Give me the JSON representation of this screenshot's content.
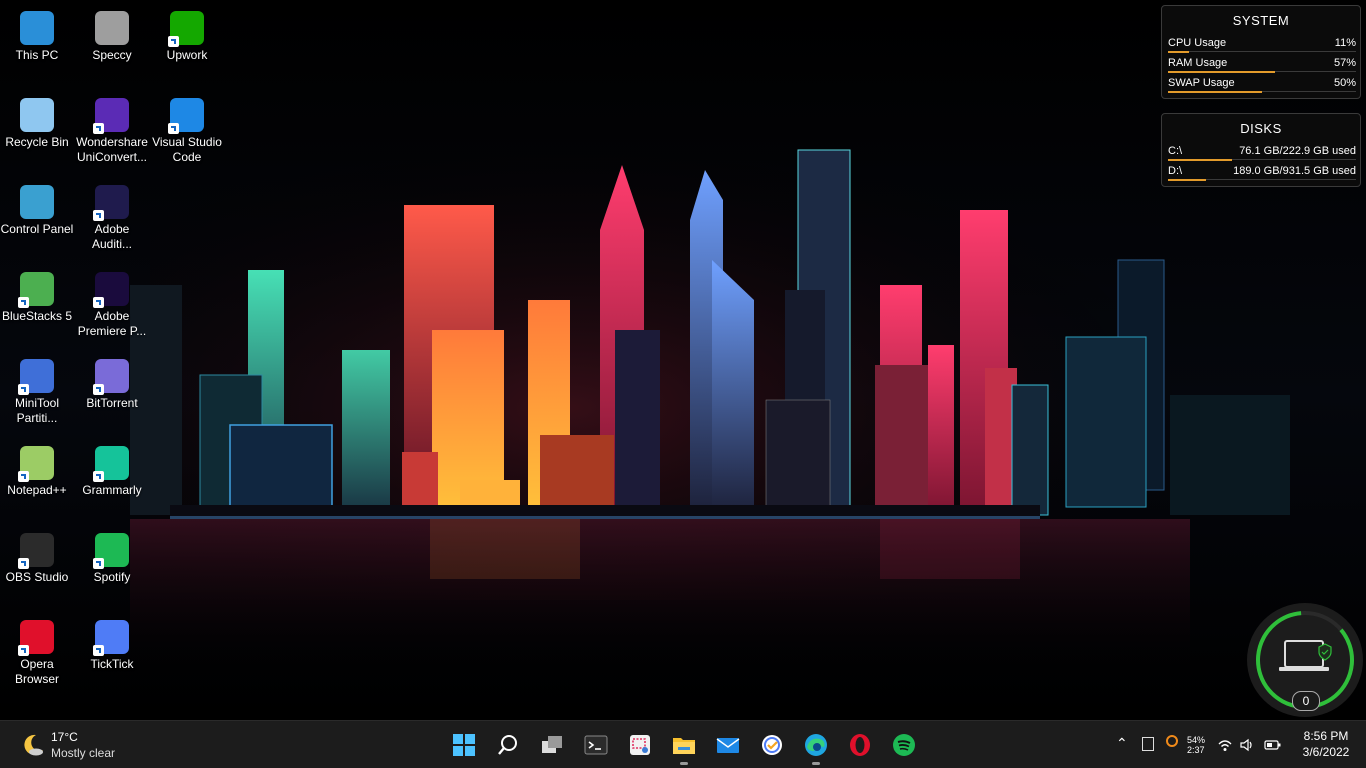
{
  "desktop_icons": [
    {
      "label": "This PC",
      "color": "#2a8fd8"
    },
    {
      "label": "Recycle Bin",
      "color": "#8fc7f0"
    },
    {
      "label": "Control Panel",
      "color": "#3aa0d0"
    },
    {
      "label": "BlueStacks 5",
      "color": "#4caf50"
    },
    {
      "label": "MiniTool Partiti...",
      "color": "#3f6fd8"
    },
    {
      "label": "Notepad++",
      "color": "#9ccc65"
    },
    {
      "label": "OBS Studio",
      "color": "#2b2b2b"
    },
    {
      "label": "Opera Browser",
      "color": "#e0102b"
    },
    {
      "label": "Speccy",
      "color": "#9e9e9e"
    },
    {
      "label": "Wondershare UniConvert...",
      "color": "#5b2bb5"
    },
    {
      "label": "Adobe Auditi...",
      "color": "#1f1b4d"
    },
    {
      "label": "Adobe Premiere P...",
      "color": "#1a0b3d"
    },
    {
      "label": "BitTorrent",
      "color": "#7a6bd8"
    },
    {
      "label": "Grammarly",
      "color": "#15c39a"
    },
    {
      "label": "Spotify",
      "color": "#1db954"
    },
    {
      "label": "TickTick",
      "color": "#4f7cf6"
    },
    {
      "label": "Upwork",
      "color": "#14a800"
    },
    {
      "label": "Visual Studio Code",
      "color": "#1e88e5"
    }
  ],
  "system_widget": {
    "title": "SYSTEM",
    "rows": [
      {
        "label": "CPU Usage",
        "value": "11%",
        "fraction": 0.11
      },
      {
        "label": "RAM Usage",
        "value": "57%",
        "fraction": 0.57
      },
      {
        "label": "SWAP Usage",
        "value": "50%",
        "fraction": 0.5
      }
    ]
  },
  "disks_widget": {
    "title": "DISKS",
    "rows": [
      {
        "label": "C:\\",
        "value": "76.1 GB/222.9 GB used",
        "fraction": 0.34
      },
      {
        "label": "D:\\",
        "value": "189.0 GB/931.5 GB used",
        "fraction": 0.2
      }
    ]
  },
  "security_widget": {
    "count": "0",
    "ring_color": "#2fbf3a"
  },
  "weather": {
    "temp": "17°C",
    "desc": "Mostly clear"
  },
  "taskbar_apps": [
    {
      "name": "start",
      "running": false
    },
    {
      "name": "search",
      "running": false
    },
    {
      "name": "task-view",
      "running": false
    },
    {
      "name": "terminal",
      "running": false
    },
    {
      "name": "snipping-tool",
      "running": false
    },
    {
      "name": "file-explorer",
      "running": true
    },
    {
      "name": "mail",
      "running": false
    },
    {
      "name": "ticktick",
      "running": false
    },
    {
      "name": "edge",
      "running": true
    },
    {
      "name": "opera",
      "running": false
    },
    {
      "name": "spotify",
      "running": false
    }
  ],
  "tray": {
    "battery_pct": "54%",
    "battery_time": "2:37",
    "time": "8:56 PM",
    "date": "3/6/2022"
  },
  "accent": "#e39b2b"
}
